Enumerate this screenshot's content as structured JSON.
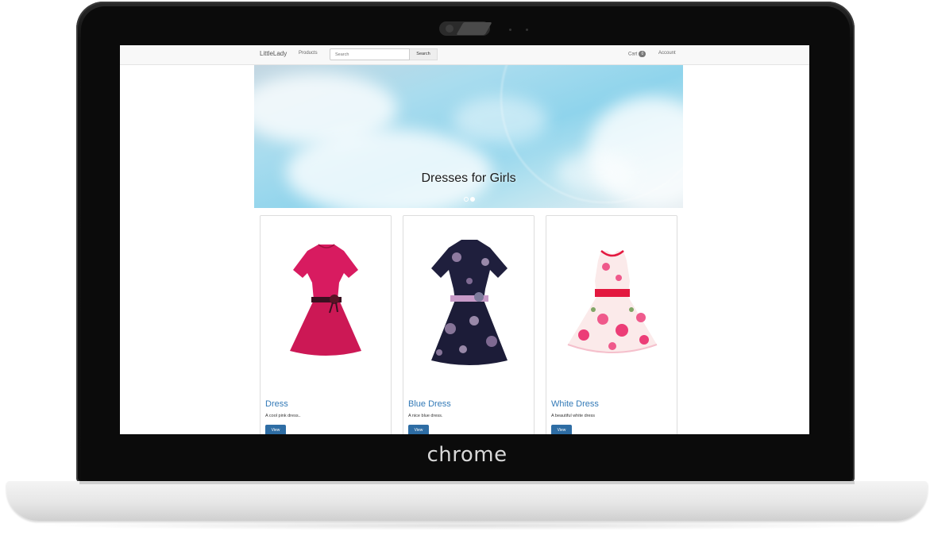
{
  "device": {
    "label": "chrome"
  },
  "navbar": {
    "brand": "LittleLady",
    "products_label": "Products",
    "search_placeholder": "Search",
    "search_button": "Search",
    "cart_label": "Cart",
    "cart_count": "0",
    "account_label": "Account"
  },
  "hero": {
    "caption": "Dresses for Girls",
    "slides": 2,
    "active_slide": 2
  },
  "products": [
    {
      "title": "Dress",
      "description": "A cool pink dress..",
      "button": "View",
      "image": "pink-dress-image"
    },
    {
      "title": "Blue Dress",
      "description": "A nice blue dress.",
      "button": "View",
      "image": "blue-floral-dress-image"
    },
    {
      "title": "White Dress",
      "description": "A beautiful white dress",
      "button": "View",
      "image": "white-floral-dress-image"
    }
  ],
  "colors": {
    "link": "#337ab7",
    "button": "#2e6da4",
    "navbar_bg": "#f8f8f8",
    "pink_dress": "#d81b60",
    "navy_dress": "#1f1f3d"
  }
}
